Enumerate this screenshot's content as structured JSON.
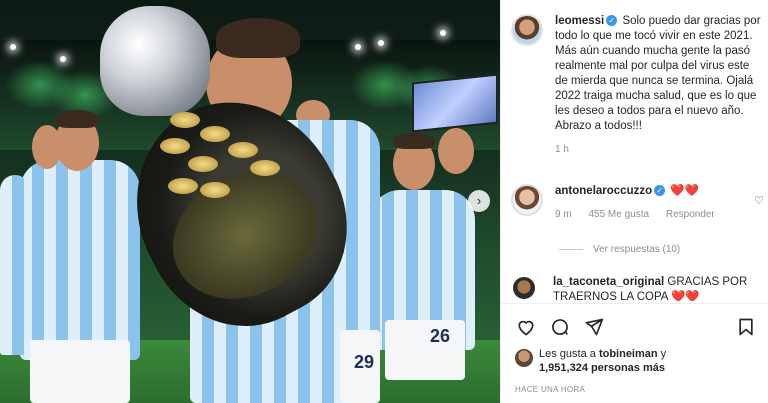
{
  "post": {
    "author": "leomessi",
    "caption": "Solo puedo dar gracias por todo lo que me tocó vivir en este 2021. Más aún cuando mucha gente la pasó realmente mal por culpa del virus este de mierda que nunca se termina. Ojalá 2022 traiga mucha salud, que es lo que les deseo a todos para el nuevo año. Abrazo a todos!!!",
    "time": "1 h",
    "photo_numbers": {
      "left": "26",
      "right": "29"
    }
  },
  "comments": [
    {
      "user": "antonelaroccuzzo",
      "text": "❤️❤️",
      "time": "9 m",
      "likes": "455 Me gusta",
      "reply_label": "Responder",
      "view_replies": "Ver respuestas (10)"
    },
    {
      "user": "la_taconeta_original",
      "text": "GRACIAS POR TRAERNOS LA COPA ❤️❤️"
    }
  ],
  "likes_line": {
    "prefix": "Les gusta a ",
    "user": "tobineiman",
    "connector": " y",
    "count": "1,951,324 personas más"
  },
  "timestamp": "HACE UNA HORA",
  "icons": [
    "heart-icon",
    "comment-icon",
    "share-icon",
    "bookmark-icon",
    "verified-icon",
    "chevron-right-icon"
  ],
  "colors": {
    "heart": "#ed4956",
    "verified": "#3897f0",
    "meta": "#8e8e8e"
  }
}
